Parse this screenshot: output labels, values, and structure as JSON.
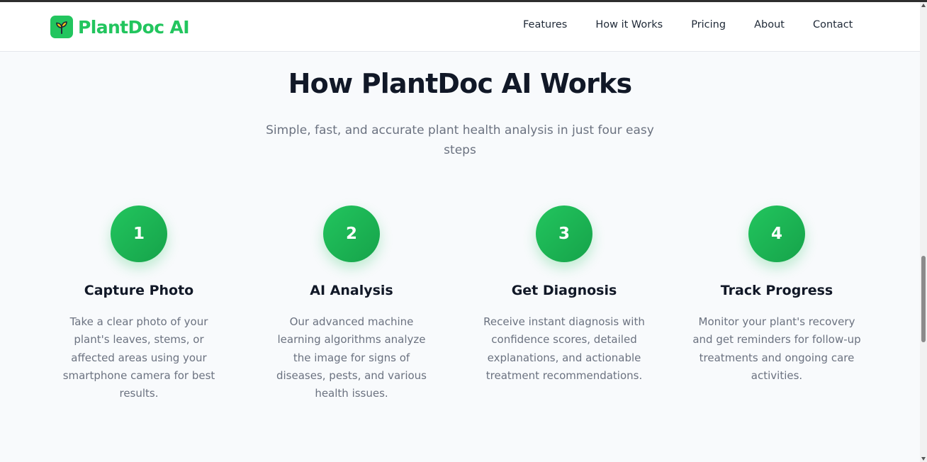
{
  "brand": {
    "name": "PlantDoc AI",
    "logo_icon": "sprout-icon",
    "color": "#22c55e"
  },
  "nav": [
    {
      "label": "Features"
    },
    {
      "label": "How it Works"
    },
    {
      "label": "Pricing"
    },
    {
      "label": "About"
    },
    {
      "label": "Contact"
    }
  ],
  "section": {
    "title": "How PlantDoc AI Works",
    "subtitle": "Simple, fast, and accurate plant health analysis in just four easy steps"
  },
  "steps": [
    {
      "number": "1",
      "title": "Capture Photo",
      "description": "Take a clear photo of your plant's leaves, stems, or affected areas using your smartphone camera for best results."
    },
    {
      "number": "2",
      "title": "AI Analysis",
      "description": "Our advanced machine learning algorithms analyze the image for signs of diseases, pests, and various health issues."
    },
    {
      "number": "3",
      "title": "Get Diagnosis",
      "description": "Receive instant diagnosis with confidence scores, detailed explanations, and actionable treatment recommendations."
    },
    {
      "number": "4",
      "title": "Track Progress",
      "description": "Monitor your plant's recovery and get reminders for follow-up treatments and ongoing care activities."
    }
  ],
  "colors": {
    "accent": "#22c55e",
    "accent_dark": "#16a34a",
    "text": "#111827",
    "muted": "#6b7280",
    "background": "#f8fafc"
  }
}
